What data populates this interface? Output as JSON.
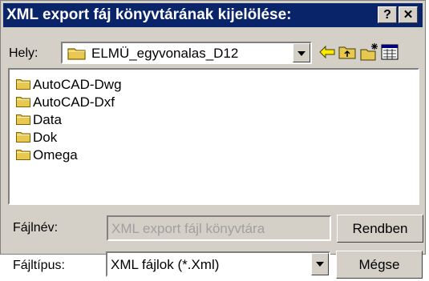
{
  "title": "XML export fáj könyvtárának kijelölése:",
  "title_buttons": {
    "help": "?",
    "close": "✕"
  },
  "location": {
    "label": "Hely:",
    "value": "ELMÜ_egyvonalas_D12"
  },
  "toolbar": {
    "back": "back-icon",
    "up": "up-folder-icon",
    "new_folder": "new-folder-icon",
    "view": "view-menu-icon"
  },
  "files": [
    "AutoCAD-Dwg",
    "AutoCAD-Dxf",
    "Data",
    "Dok",
    "Omega"
  ],
  "filename": {
    "label": "Fájlnév:",
    "placeholder": "XML export fájl könyvtára"
  },
  "filetype": {
    "label": "Fájltípus:",
    "value": "XML fájlok (*.Xml)"
  },
  "buttons": {
    "ok": "Rendben",
    "cancel": "Mégse"
  },
  "colors": {
    "title_bg": "#0a246a",
    "dialog_bg": "#d4d0c8",
    "folder": "#e8c850"
  }
}
